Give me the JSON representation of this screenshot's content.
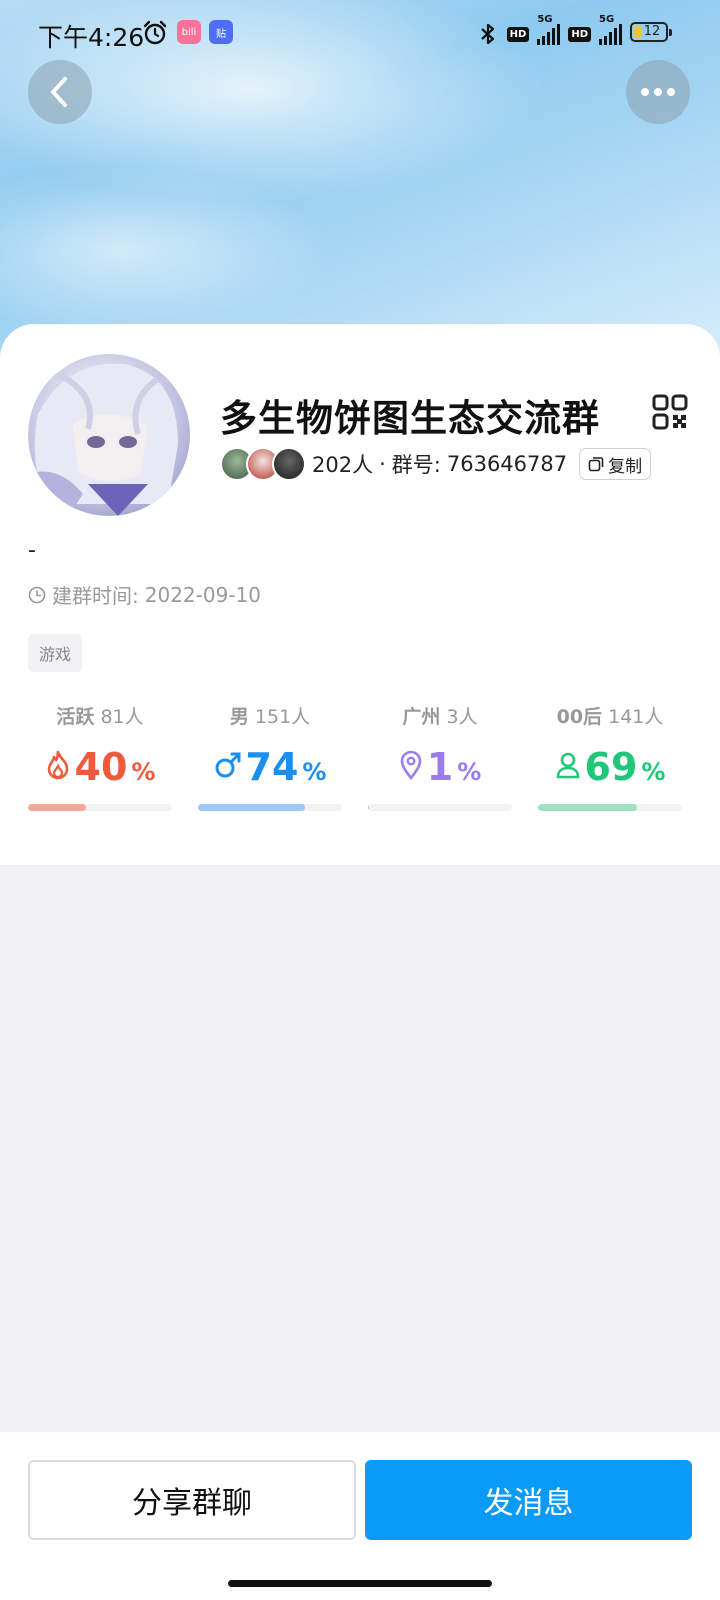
{
  "status_bar": {
    "time": "下午4:26",
    "apps": [
      {
        "name": "bilibili-app-icon",
        "text": "bili",
        "color": "#fb7299"
      },
      {
        "name": "tieba-app-icon",
        "text": "贴",
        "color": "#4d6ef5"
      }
    ],
    "hd": "HD",
    "network": "5G",
    "battery": "12"
  },
  "group": {
    "name": "多生物饼图生态交流群",
    "member_count": "202人",
    "separator": "·",
    "id_label": "群号:",
    "id": "763646787",
    "copy_label": "复制",
    "description": "-",
    "created_label": "建群时间:",
    "created_date": "2022-09-10",
    "tag": "游戏"
  },
  "stats": [
    {
      "label": "活跃",
      "count": "81人",
      "value": "40",
      "percent": "%",
      "fill": 0.4,
      "color": "#f05a3c",
      "bar_color": "#f4a79a",
      "icon": "flame-icon"
    },
    {
      "label": "男",
      "count": "151人",
      "value": "74",
      "percent": "%",
      "fill": 0.74,
      "color": "#1a8ff0",
      "bar_color": "#9cc7f6",
      "icon": "male-icon"
    },
    {
      "label": "广州",
      "count": "3人",
      "value": "1",
      "percent": "%",
      "fill": 0.01,
      "color": "#9a7cf0",
      "bar_color": "#c9bdf4",
      "icon": "location-pin-icon"
    },
    {
      "label": "00后",
      "count": "141人",
      "value": "69",
      "percent": "%",
      "fill": 0.69,
      "color": "#1fc879",
      "bar_color": "#9fe0bf",
      "icon": "person-icon"
    }
  ],
  "actions": {
    "share": "分享群聊",
    "send": "发消息"
  }
}
